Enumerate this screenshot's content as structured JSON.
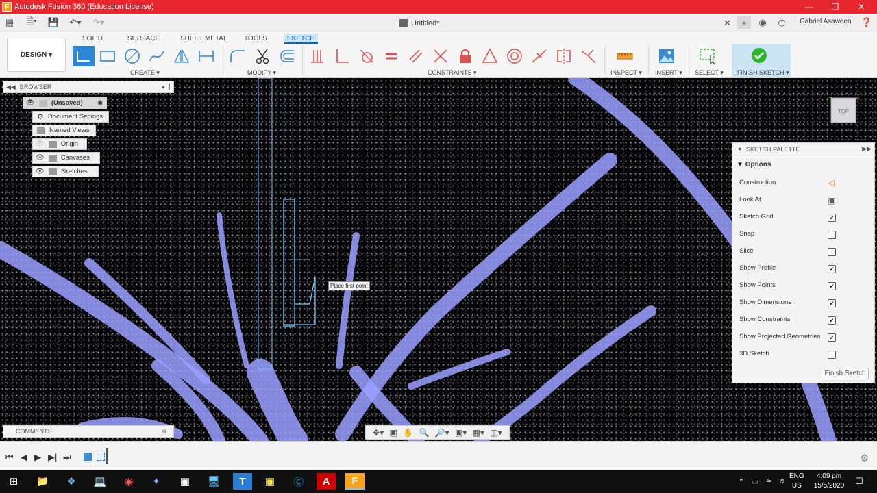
{
  "window": {
    "title": "Autodesk Fusion 360 (Education License)",
    "logo_letter": "F"
  },
  "qat": {
    "document_title": "Untitled*",
    "user_name": "Gabriel Asaween"
  },
  "ribbon": {
    "workspace_button": "DESIGN",
    "tabs": [
      "SOLID",
      "SURFACE",
      "SHEET METAL",
      "TOOLS",
      "SKETCH"
    ],
    "active_tab": "SKETCH",
    "groups": {
      "create": "CREATE",
      "modify": "MODIFY",
      "constraints": "CONSTRAINTS",
      "inspect": "INSPECT",
      "insert": "INSERT",
      "select": "SELECT",
      "finish_sketch": "FINISH SKETCH"
    }
  },
  "browser": {
    "title": "BROWSER",
    "nodes": [
      "(Unsaved)",
      "Document Settings",
      "Named Views",
      "Origin",
      "Canvases",
      "Sketches"
    ]
  },
  "comments": {
    "title": "COMMENTS"
  },
  "tooltip": {
    "text": "Place first point"
  },
  "viewcube": {
    "face_label": "TOP"
  },
  "palette": {
    "title": "SKETCH PALETTE",
    "section": "Options",
    "rows": [
      {
        "label": "Construction",
        "control": "construction-icon",
        "checked": null
      },
      {
        "label": "Look At",
        "control": "look-at-icon",
        "checked": null
      },
      {
        "label": "Sketch Grid",
        "control": "checkbox",
        "checked": true
      },
      {
        "label": "Snap",
        "control": "checkbox",
        "checked": false
      },
      {
        "label": "Slice",
        "control": "checkbox",
        "checked": false
      },
      {
        "label": "Show Profile",
        "control": "checkbox",
        "checked": true
      },
      {
        "label": "Show Points",
        "control": "checkbox",
        "checked": true
      },
      {
        "label": "Show Dimensions",
        "control": "checkbox",
        "checked": true
      },
      {
        "label": "Show Constraints",
        "control": "checkbox",
        "checked": true
      },
      {
        "label": "Show Projected Geometries",
        "control": "checkbox",
        "checked": true
      },
      {
        "label": "3D Sketch",
        "control": "checkbox",
        "checked": false
      }
    ],
    "finish_button": "Finish Sketch"
  },
  "taskbar": {
    "language": "ENG",
    "region": "US",
    "time": "4:09 pm",
    "date": "15/5/2020"
  },
  "colors": {
    "titlebar": "#e8262e",
    "accent": "#0a64b4",
    "finish_green": "#2db52d",
    "sketch_line": "#4aa3df",
    "canvas_structure": "#9aa0ff"
  }
}
